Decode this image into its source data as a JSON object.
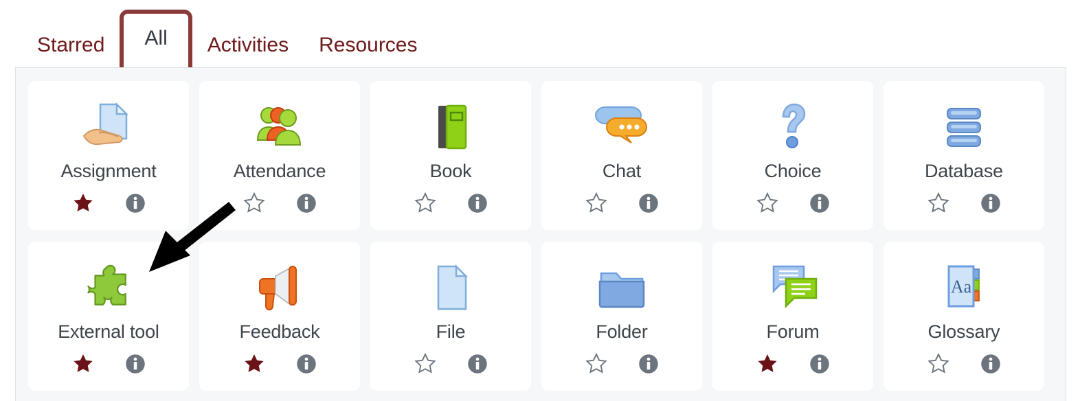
{
  "tabs": [
    {
      "label": "Starred",
      "active": false
    },
    {
      "label": "All",
      "active": true
    },
    {
      "label": "Activities",
      "active": false
    },
    {
      "label": "Resources",
      "active": false
    }
  ],
  "colors": {
    "tab_link": "#6f1a1a",
    "tab_active_border": "#8b3a3a",
    "tab_active_text": "#343a40",
    "card_label": "#3d444b",
    "star_filled": "#6a1216",
    "star_empty_stroke": "#6c757d",
    "info_circle": "#6c757d",
    "panel_bg": "#f6f7f9",
    "panel_border": "#dde1e6",
    "card_bg": "#ffffff",
    "annotation_arrow": "#000000"
  },
  "actions": {
    "star_filled_name": "Starred",
    "star_empty_name": "Not starred",
    "info_name": "Information"
  },
  "grid": {
    "rows": [
      [
        {
          "label": "Assignment",
          "icon": "assignment-hand-document-icon",
          "starred": true
        },
        {
          "label": "Attendance",
          "icon": "attendance-people-icon",
          "starred": false
        },
        {
          "label": "Book",
          "icon": "book-icon",
          "starred": false
        },
        {
          "label": "Chat",
          "icon": "chat-bubbles-icon",
          "starred": false
        },
        {
          "label": "Choice",
          "icon": "choice-question-mark-icon",
          "starred": false
        },
        {
          "label": "Database",
          "icon": "database-stack-icon",
          "starred": false
        }
      ],
      [
        {
          "label": "External tool",
          "icon": "external-tool-puzzle-icon",
          "starred": true
        },
        {
          "label": "Feedback",
          "icon": "feedback-megaphone-icon",
          "starred": true
        },
        {
          "label": "File",
          "icon": "file-page-icon",
          "starred": false
        },
        {
          "label": "Folder",
          "icon": "folder-icon",
          "starred": false
        },
        {
          "label": "Forum",
          "icon": "forum-bubbles-icon",
          "starred": true
        },
        {
          "label": "Glossary",
          "icon": "glossary-aa-card-icon",
          "starred": false
        }
      ]
    ]
  },
  "annotation": {
    "type": "arrow",
    "points_to": "External tool"
  }
}
